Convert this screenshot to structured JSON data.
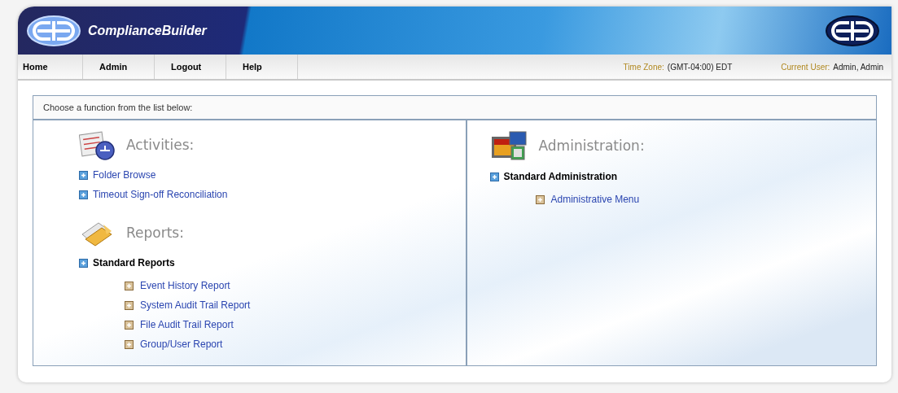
{
  "header": {
    "brand": "ComplianceBuilder"
  },
  "nav": {
    "items": [
      {
        "label": "Home"
      },
      {
        "label": "Admin"
      },
      {
        "label": "Logout"
      },
      {
        "label": "Help"
      }
    ],
    "time_zone": {
      "label": "Time Zone:",
      "value": "(GMT-04:00) EDT"
    },
    "current_user": {
      "label": "Current User:",
      "value": "Admin, Admin"
    }
  },
  "panel": {
    "title": "Choose a function from the list below:",
    "columns": [
      {
        "sections": [
          {
            "title": "Activities:",
            "kind": "calendar",
            "items": [
              {
                "kind": "link",
                "label": "Folder Browse"
              },
              {
                "kind": "link",
                "label": "Timeout Sign-off Reconciliation"
              }
            ]
          },
          {
            "title": "Reports:",
            "kind": "folder",
            "items": [
              {
                "kind": "group",
                "label": "Standard Reports",
                "children": [
                  {
                    "label": "Event History Report"
                  },
                  {
                    "label": "System Audit Trail Report"
                  },
                  {
                    "label": "File Audit Trail Report"
                  },
                  {
                    "label": "Group/User Report"
                  }
                ]
              }
            ]
          }
        ]
      },
      {
        "sections": [
          {
            "title": "Administration:",
            "kind": "monitors",
            "items": [
              {
                "kind": "group",
                "label": "Standard Administration",
                "children": [
                  {
                    "label": "Administrative Menu"
                  }
                ]
              }
            ]
          }
        ]
      }
    ]
  }
}
